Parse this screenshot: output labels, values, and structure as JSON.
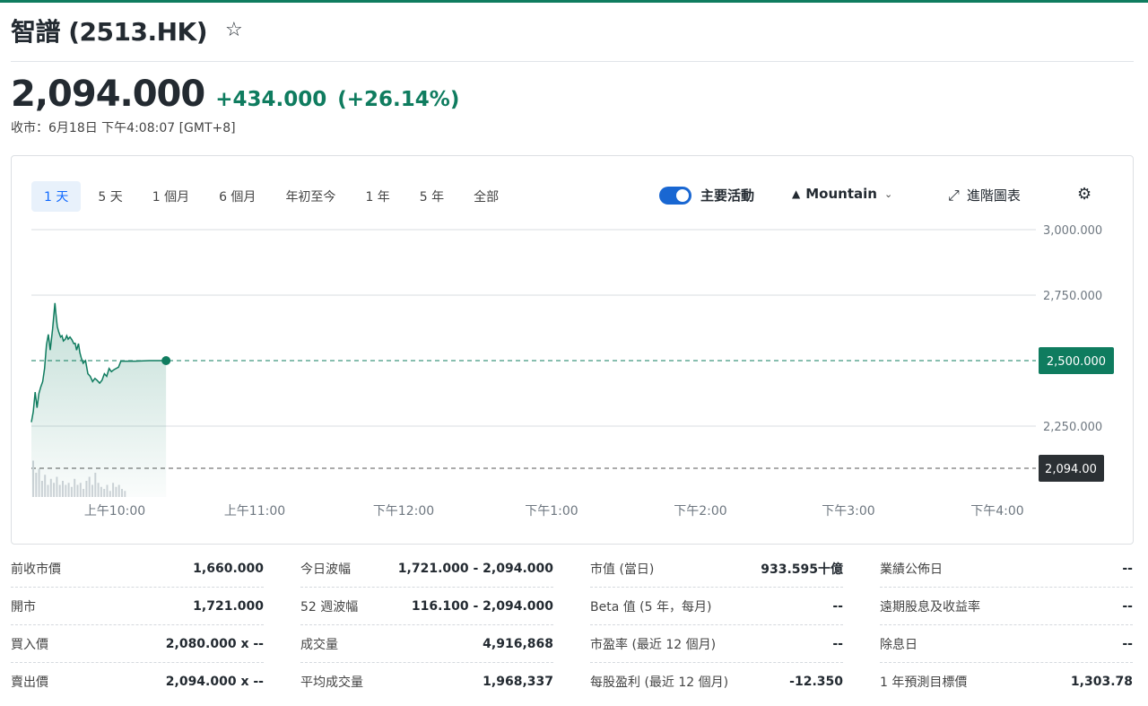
{
  "header": {
    "title": "智譜 (2513.HK)",
    "star_icon": "☆"
  },
  "quote": {
    "price": "2,094.000",
    "change": "+434.000",
    "change_pct": "(+26.14%)",
    "close_time": "收市：6月18日 下午4:08:07 [GMT+8]"
  },
  "toolbar": {
    "ranges": [
      "1 天",
      "5 天",
      "1 個月",
      "6 個月",
      "年初至今",
      "1 年",
      "5 年",
      "全部"
    ],
    "active_range": "1 天",
    "toggle_label": "主要活動",
    "chart_type_icon": "▲",
    "chart_type_label": "Mountain",
    "chevron_icon": "⌄",
    "advanced_icon": "⤢",
    "advanced_label": "進階圖表",
    "settings_icon": "⚙"
  },
  "colors": {
    "positive": "#0f7c5f",
    "accent": "#1967d2",
    "text": "#232a31"
  },
  "chart_data": {
    "type": "area",
    "y_ticks": [
      "3,000.000",
      "2,750.000",
      "2,500.000",
      "2,250.000"
    ],
    "x_ticks": [
      "上午10:00",
      "上午11:00",
      "下午12:00",
      "下午1:00",
      "下午2:00",
      "下午3:00",
      "下午4:00"
    ],
    "last_price_label": "2,500.000",
    "prev_close_label": "2,094.00",
    "grid": true,
    "points": [
      [
        0,
        2265
      ],
      [
        0.04,
        2305
      ],
      [
        0.08,
        2380
      ],
      [
        0.12,
        2320
      ],
      [
        0.16,
        2375
      ],
      [
        0.2,
        2400
      ],
      [
        0.24,
        2420
      ],
      [
        0.28,
        2470
      ],
      [
        0.32,
        2560
      ],
      [
        0.36,
        2600
      ],
      [
        0.4,
        2540
      ],
      [
        0.45,
        2620
      ],
      [
        0.48,
        2680
      ],
      [
        0.5,
        2720
      ],
      [
        0.52,
        2680
      ],
      [
        0.55,
        2630
      ],
      [
        0.58,
        2610
      ],
      [
        0.62,
        2590
      ],
      [
        0.65,
        2595
      ],
      [
        0.68,
        2575
      ],
      [
        0.72,
        2582
      ],
      [
        0.75,
        2595
      ],
      [
        0.78,
        2582
      ],
      [
        0.82,
        2590
      ],
      [
        0.86,
        2580
      ],
      [
        0.9,
        2565
      ],
      [
        0.93,
        2566
      ],
      [
        0.96,
        2540
      ],
      [
        1.0,
        2565
      ],
      [
        1.03,
        2530
      ],
      [
        1.06,
        2510
      ],
      [
        1.1,
        2490
      ],
      [
        1.15,
        2500
      ],
      [
        1.2,
        2450
      ],
      [
        1.25,
        2440
      ],
      [
        1.3,
        2420
      ],
      [
        1.35,
        2432
      ],
      [
        1.4,
        2424
      ],
      [
        1.45,
        2414
      ],
      [
        1.5,
        2425
      ],
      [
        1.55,
        2450
      ],
      [
        1.6,
        2440
      ],
      [
        1.65,
        2470
      ],
      [
        1.7,
        2458
      ],
      [
        1.75,
        2465
      ],
      [
        1.8,
        2470
      ],
      [
        1.85,
        2475
      ],
      [
        1.9,
        2498
      ],
      [
        2.0,
        2498
      ],
      [
        2.2,
        2498
      ],
      [
        2.5,
        2500
      ],
      [
        2.75,
        2500
      ],
      [
        2.86,
        2500
      ]
    ],
    "volume": [
      0.9,
      0.6,
      0.7,
      0.4,
      0.55,
      0.3,
      0.45,
      0.35,
      0.5,
      0.3,
      0.4,
      0.3,
      0.35,
      0.25,
      0.45,
      0.3,
      0.35,
      0.2,
      0.4,
      0.5,
      0.3,
      0.6,
      0.35,
      0.25,
      0.2,
      0.3,
      0.15,
      0.35,
      0.25,
      0.3,
      0.2,
      0.15
    ]
  },
  "stats": [
    [
      {
        "label": "前收市價",
        "value": "1,660.000"
      },
      {
        "label": "開市",
        "value": "1,721.000"
      },
      {
        "label": "買入價",
        "value": "2,080.000 x --"
      },
      {
        "label": "賣出價",
        "value": "2,094.000 x --"
      }
    ],
    [
      {
        "label": "今日波幅",
        "value": "1,721.000 - 2,094.000"
      },
      {
        "label": "52 週波幅",
        "value": "116.100 - 2,094.000"
      },
      {
        "label": "成交量",
        "value": "4,916,868"
      },
      {
        "label": "平均成交量",
        "value": "1,968,337"
      }
    ],
    [
      {
        "label": "市值 (當日)",
        "value": "933.595十億"
      },
      {
        "label": "Beta 值 (5 年，每月)",
        "value": "--"
      },
      {
        "label": "市盈率 (最近 12 個月)",
        "value": "--"
      },
      {
        "label": "每股盈利 (最近 12 個月)",
        "value": "-12.350"
      }
    ],
    [
      {
        "label": "業績公佈日",
        "value": "--"
      },
      {
        "label": "遠期股息及收益率",
        "value": "--"
      },
      {
        "label": "除息日",
        "value": "--"
      },
      {
        "label": "1 年預測目標價",
        "value": "1,303.78"
      }
    ]
  ]
}
